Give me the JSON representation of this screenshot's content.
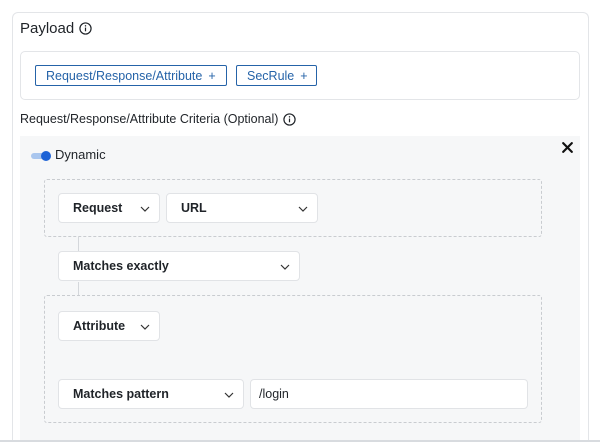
{
  "payload": {
    "title": "Payload",
    "info_icon": "info-icon",
    "chips": [
      {
        "label": "Request/Response/Attribute",
        "icon": "+"
      },
      {
        "label": "SecRule",
        "icon": "+"
      }
    ]
  },
  "criteria": {
    "title": "Request/Response/Attribute Criteria (Optional)",
    "info_icon": "info-icon",
    "toggle": {
      "label": "Dynamic",
      "state": "on"
    },
    "close_icon": "close-icon",
    "group1": {
      "source_select": "Request",
      "field_select": "URL"
    },
    "operator_select": "Matches exactly",
    "group2": {
      "source_select": "Attribute",
      "operator_select": "Matches pattern",
      "value": "/login"
    }
  },
  "colors": {
    "accent": "#2563a8",
    "toggle_on": "#1d63d6",
    "border": "#e3e5e8",
    "area_bg": "#f6f7f8"
  }
}
